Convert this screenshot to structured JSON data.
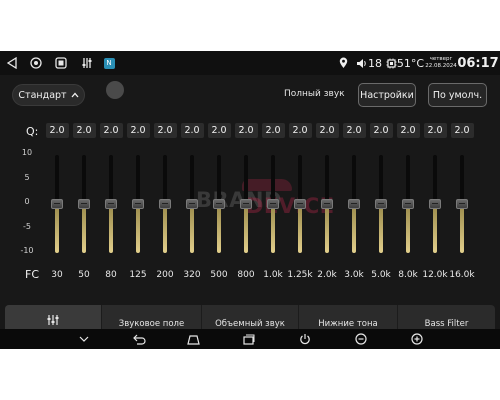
{
  "status_bar": {
    "icons": [
      "back-triangle-icon",
      "home-circle-icon",
      "recent-square-icon",
      "equalizer-app-icon",
      "app-badge-icon"
    ],
    "app_badge_text": "N",
    "volume": "18",
    "temperature": "51°C",
    "weekday": "четверг",
    "date": "22.08.2024",
    "time": "06:17"
  },
  "controls": {
    "preset_label": "Стандарт",
    "full_sound_label": "Полный звук",
    "settings_button": "Настройки",
    "default_button": "По умолч."
  },
  "eq": {
    "q_label": "Q:",
    "fc_label": "FC",
    "scale": [
      "10",
      "5",
      "0",
      "-5",
      "-10"
    ],
    "q_values": [
      "2.0",
      "2.0",
      "2.0",
      "2.0",
      "2.0",
      "2.0",
      "2.0",
      "2.0",
      "2.0",
      "2.0",
      "2.0",
      "2.0",
      "2.0",
      "2.0",
      "2.0",
      "2.0"
    ],
    "frequencies": [
      "30",
      "50",
      "80",
      "125",
      "200",
      "320",
      "500",
      "800",
      "1.0k",
      "1.25k",
      "2.0k",
      "3.0k",
      "5.0k",
      "8.0k",
      "12.0k",
      "16.0k"
    ],
    "gains_db": [
      0,
      0,
      0,
      0,
      0,
      0,
      0,
      0,
      0,
      0,
      0,
      0,
      0,
      0,
      0,
      0
    ],
    "gain_range_db": [
      -10,
      10
    ],
    "fill_color": "#e2cf8c"
  },
  "watermark": {
    "left": "BRAND",
    "right": "DEVICE"
  },
  "tabs": [
    {
      "label": "",
      "icon": "equalizer-sliders-icon",
      "active": true
    },
    {
      "label": "Звуковое поле",
      "active": false
    },
    {
      "label": "Объемный звук",
      "active": false
    },
    {
      "label": "Нижние тона",
      "active": false
    },
    {
      "label": "Bass Filter",
      "active": false
    }
  ],
  "nav_bar": {
    "icons": [
      "chevron-down-icon",
      "back-arrow-icon",
      "home-icon",
      "recent-apps-icon",
      "power-icon",
      "volume-down-icon",
      "volume-up-icon"
    ]
  }
}
